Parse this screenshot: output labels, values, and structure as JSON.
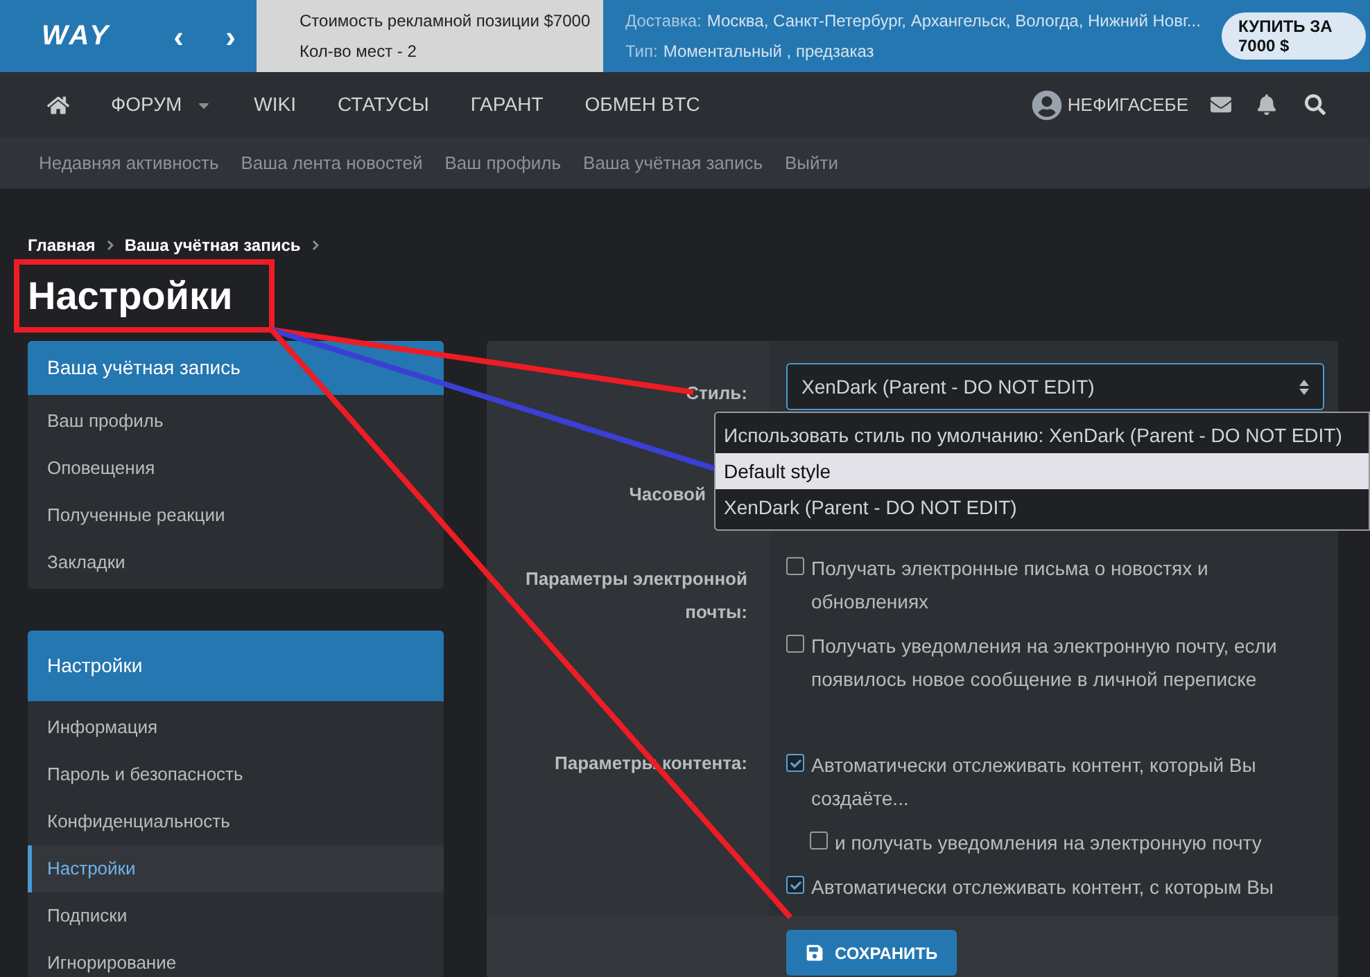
{
  "banner": {
    "logo_text": "WAY",
    "prev": "‹",
    "next": "›",
    "price": "Стоимость рекламной позиции $7000",
    "slots": "Кол-во мест - 2",
    "delivery_label": "Доставка:",
    "delivery": "Москва, Санкт-Петербург, Архангельск, Вологда, Нижний Новг...",
    "type_label": "Тип:",
    "type": "Моментальный , предзаказ",
    "buy_button": "КУПИТЬ ЗА 7000 $"
  },
  "nav": {
    "items": [
      {
        "label": "ФОРУМ",
        "kind": "menu"
      },
      {
        "label": "WIKI",
        "kind": "link"
      },
      {
        "label": "СТАТУСЫ",
        "kind": "link"
      },
      {
        "label": "ГАРАНТ",
        "kind": "link"
      },
      {
        "label": "ОБМЕН BTC",
        "kind": "link"
      }
    ],
    "username": "НЕФИГАСЕБЕ"
  },
  "subnav": [
    "Недавняя активность",
    "Ваша лента новостей",
    "Ваш профиль",
    "Ваша учётная запись",
    "Выйти"
  ],
  "breadcrumb": [
    "Главная",
    "Ваша учётная запись"
  ],
  "title": "Настройки",
  "sidebar": [
    {
      "title": "Ваша учётная запись",
      "items": [
        {
          "label": "Ваш профиль",
          "selected": false
        },
        {
          "label": "Оповещения",
          "selected": false
        },
        {
          "label": "Полученные реакции",
          "selected": false
        },
        {
          "label": "Закладки",
          "selected": false
        }
      ]
    },
    {
      "title": "Настройки",
      "items": [
        {
          "label": "Информация",
          "selected": false
        },
        {
          "label": "Пароль и безопасность",
          "selected": false
        },
        {
          "label": "Конфиденциальность",
          "selected": false
        },
        {
          "label": "Настройки",
          "selected": true
        },
        {
          "label": "Подписки",
          "selected": false
        },
        {
          "label": "Игнорирование",
          "selected": false
        }
      ]
    }
  ],
  "form": {
    "style_label": "Стиль:",
    "style_value": "XenDark (Parent - DO NOT EDIT)",
    "style_options": [
      {
        "label": "Использовать стиль по умолчанию: XenDark (Parent - DO NOT EDIT)",
        "selected": false
      },
      {
        "label": "Default style",
        "selected": true
      },
      {
        "label": "XenDark (Parent - DO NOT EDIT)",
        "selected": false
      }
    ],
    "timezone_label": "Часовой",
    "email_label": "Параметры электронной почты:",
    "email_options": [
      {
        "label": "Получать электронные письма о новостях и обновлениях",
        "checked": false
      },
      {
        "label": "Получать уведомления на электронную почту, если появилось новое сообщение в личной переписке",
        "checked": false
      }
    ],
    "content_label": "Параметры контента:",
    "content_options": [
      {
        "label": "Автоматически отслеживать контент, который Вы создаёте...",
        "checked": true,
        "children": [
          {
            "label": "и получать уведомления на электронную почту",
            "checked": false
          }
        ]
      },
      {
        "label": "Автоматически отслеживать контент, с которым Вы",
        "checked": true
      }
    ],
    "save_button": "СОХРАНИТЬ"
  }
}
